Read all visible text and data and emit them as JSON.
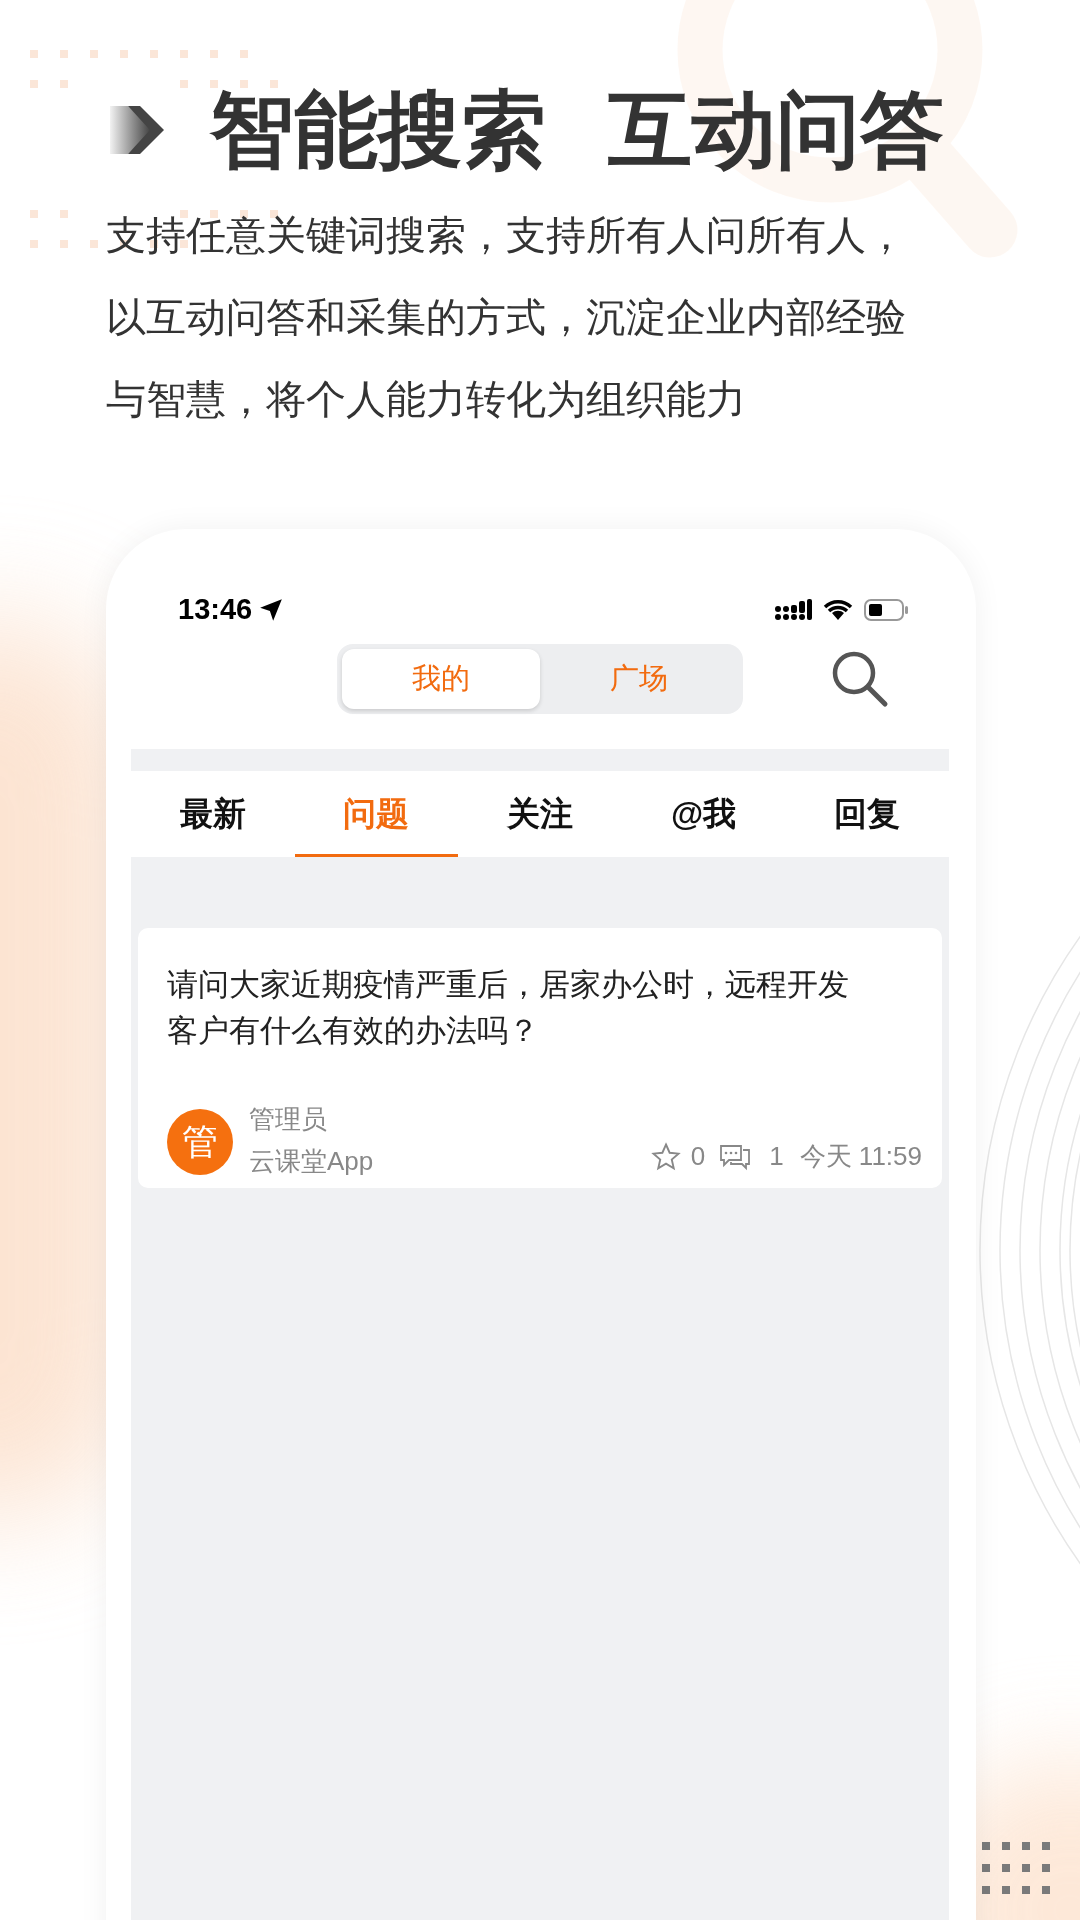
{
  "headline": {
    "title_left": "智能搜索",
    "title_right": "互动问答",
    "description": [
      "支持任意关键词搜索，支持所有人问所有人，",
      "以互动问答和采集的方式，沉淀企业内部经验",
      "与智慧，将个人能力转化为组织能力"
    ]
  },
  "phone": {
    "status_bar": {
      "time": "13:46"
    },
    "segments": [
      {
        "label": "我的",
        "selected": true
      },
      {
        "label": "广场",
        "selected": false
      }
    ],
    "tabs": [
      {
        "label": "最新",
        "selected": false
      },
      {
        "label": "问题",
        "selected": true
      },
      {
        "label": "关注",
        "selected": false
      },
      {
        "label": "@我",
        "selected": false
      },
      {
        "label": "回复",
        "selected": false
      }
    ],
    "posts": [
      {
        "question": "请问大家近期疫情严重后，居家办公时，远程开发客户有什么有效的办法吗？",
        "avatar": "管",
        "author": "管理员",
        "source": "云课堂App",
        "stars": "0",
        "comments": "1",
        "time": "今天 11:59"
      }
    ]
  }
}
